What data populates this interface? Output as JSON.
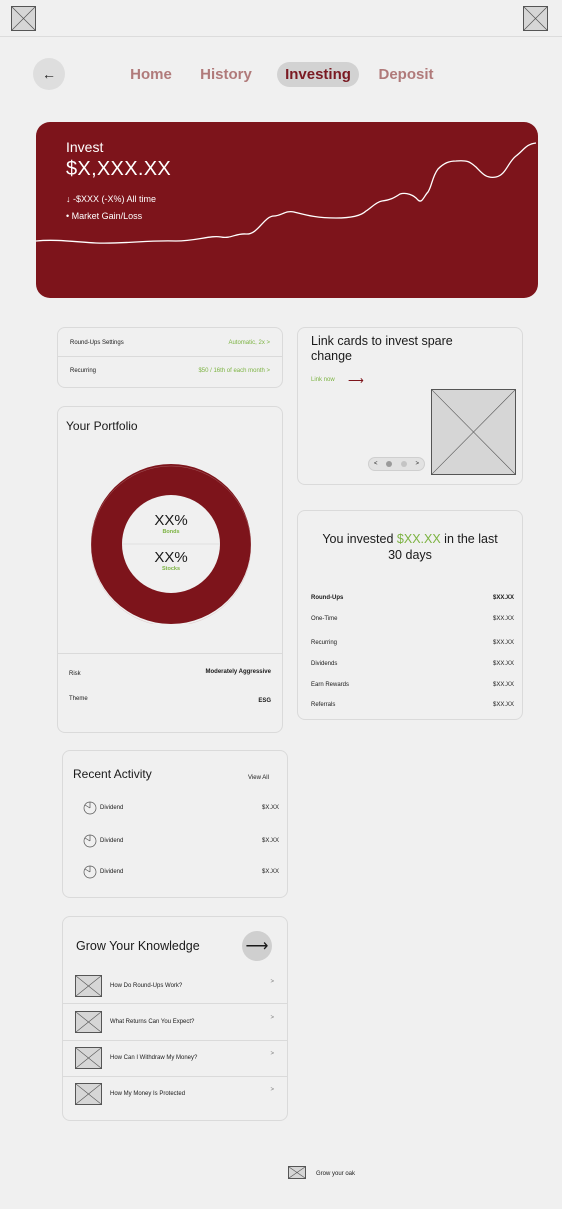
{
  "nav": {
    "back_icon": "←",
    "items": [
      {
        "label": "Home"
      },
      {
        "label": "History"
      },
      {
        "label": "Investing"
      },
      {
        "label": "Deposit"
      }
    ]
  },
  "hero": {
    "title": "Invest",
    "value": "$X,XXX.XX",
    "change": "↓ -$XXX (-X%) All time",
    "legend": "• Market Gain/Loss",
    "background": "#7d141b"
  },
  "settings": {
    "roundups_label": "Round-Ups Settings",
    "roundups_value": "Automatic, 2x   >",
    "recurring_label": "Recurring",
    "recurring_value": "$50 / 16th of each month   >"
  },
  "portfolio": {
    "title": "Your Portfolio",
    "bonds_value": "XX%",
    "bonds_label": "Bonds",
    "stocks_value": "XX%",
    "stocks_label": "Stocks",
    "risk_label": "Risk",
    "risk_value": "Moderately Aggressive",
    "theme_label": "Theme",
    "theme_value": "ESG"
  },
  "link_cards": {
    "title": "Link cards to invest spare change",
    "link_label": "Link now",
    "arrow_icon": "⟶",
    "prev_icon": "<",
    "next_icon": ">"
  },
  "invested": {
    "title_pre": "You invested ",
    "title_amount": "$XX.XX",
    "title_post": " in the last 30 days",
    "rows": [
      {
        "label": "Round-Ups",
        "value": "$XX.XX"
      },
      {
        "label": "One-Time",
        "value": "$XX.XX"
      },
      {
        "label": "Recurring",
        "value": "$XX.XX"
      },
      {
        "label": "Dividends",
        "value": "$XX.XX"
      },
      {
        "label": "Earn Rewards",
        "value": "$XX.XX"
      },
      {
        "label": "Referrals",
        "value": "$XX.XX"
      }
    ]
  },
  "activity": {
    "title": "Recent Activity",
    "view_all": "View All",
    "rows": [
      {
        "label": "Dividend",
        "value": "$X.XX",
        "icon": "pie-chart-icon"
      },
      {
        "label": "Dividend",
        "value": "$X.XX",
        "icon": "pie-chart-icon"
      },
      {
        "label": "Dividend",
        "value": "$X.XX",
        "icon": "pie-chart-icon"
      }
    ]
  },
  "knowledge": {
    "title": "Grow Your Knowledge",
    "arrow_icon": "⟶",
    "items": [
      {
        "label": "How Do Round-Ups Work?",
        "chevron": ">"
      },
      {
        "label": "What Returns Can You Expect?",
        "chevron": ">"
      },
      {
        "label": "How Can I Withdraw My Money?",
        "chevron": ">"
      },
      {
        "label": "How My Money Is Protected",
        "chevron": ">"
      }
    ]
  },
  "footer": {
    "text": "Grow your oak"
  },
  "colors": {
    "accent": "#7d141b",
    "positive": "#7cb342",
    "nav_inactive": "#b07a7a"
  }
}
